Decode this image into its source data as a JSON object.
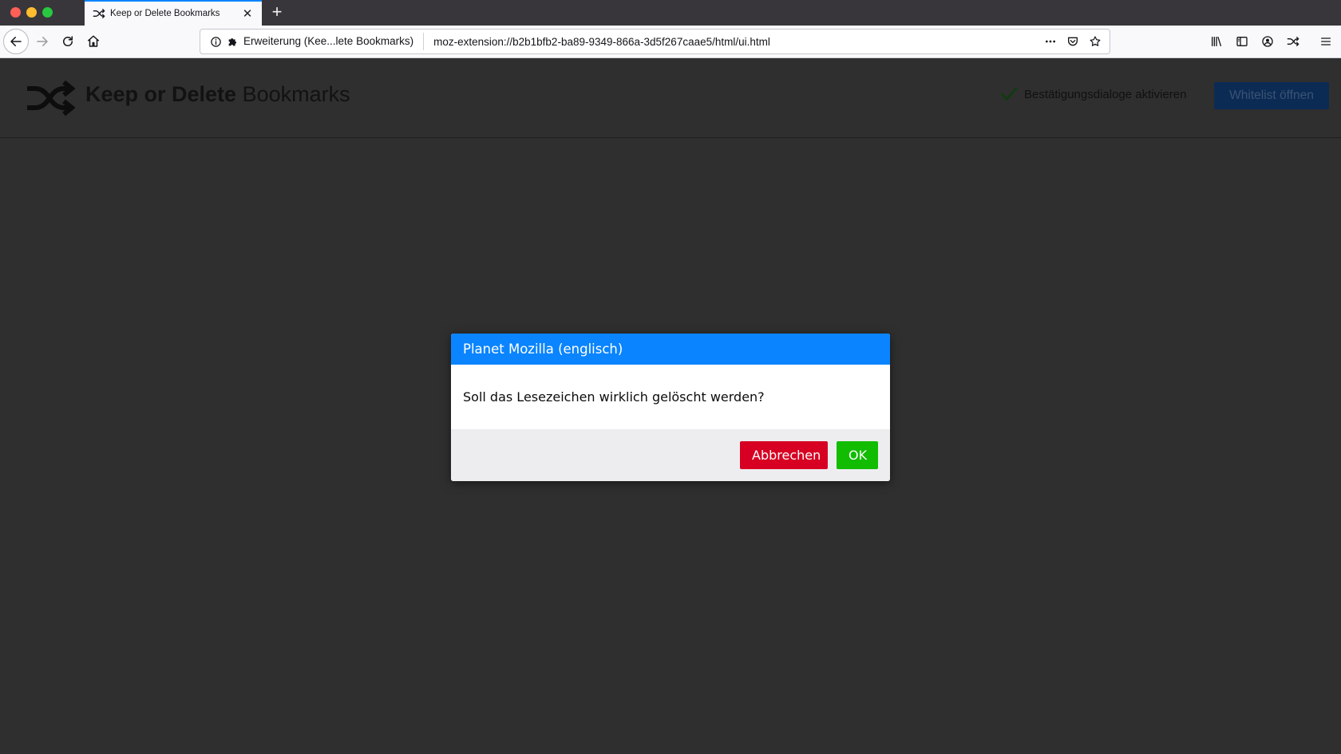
{
  "browser": {
    "tab": {
      "title": "Keep or Delete Bookmarks",
      "close_glyph": "✕"
    },
    "new_tab_glyph": "+",
    "urlbar": {
      "identity": "Erweiterung (Kee...lete Bookmarks)",
      "url": "moz-extension://b2b1bfb2-ba89-9349-866a-3d5f267caae5/html/ui.html"
    }
  },
  "app": {
    "title_bold": "Keep or Delete",
    "title_light": "Bookmarks",
    "confirm_dialogs_label": "Bestätigungsdialoge aktivieren",
    "whitelist_button": "Whitelist öffnen"
  },
  "dialog": {
    "title": "Planet Mozilla (englisch)",
    "message": "Soll das Lesezeichen wirklich gelöscht werden?",
    "cancel_label": "Abbrechen",
    "ok_label": "OK"
  },
  "colors": {
    "accent": "#0a84ff",
    "cancel": "#d70022",
    "ok": "#12bc00",
    "page_bg": "#2f2f2f"
  },
  "icons": {
    "tab": "shuffle-icon",
    "nav": [
      "back-arrow-icon",
      "forward-arrow-icon",
      "reload-icon",
      "home-icon"
    ],
    "urlbar": [
      "info-icon",
      "puzzle-extension-icon",
      "more-dots-icon",
      "pocket-icon",
      "bookmark-star-icon"
    ],
    "toolbar": [
      "library-icon",
      "sidebar-icon",
      "account-icon",
      "shuffle-icon",
      "menu-icon"
    ],
    "app": [
      "shuffle-logo-icon",
      "checkmark-icon"
    ]
  }
}
